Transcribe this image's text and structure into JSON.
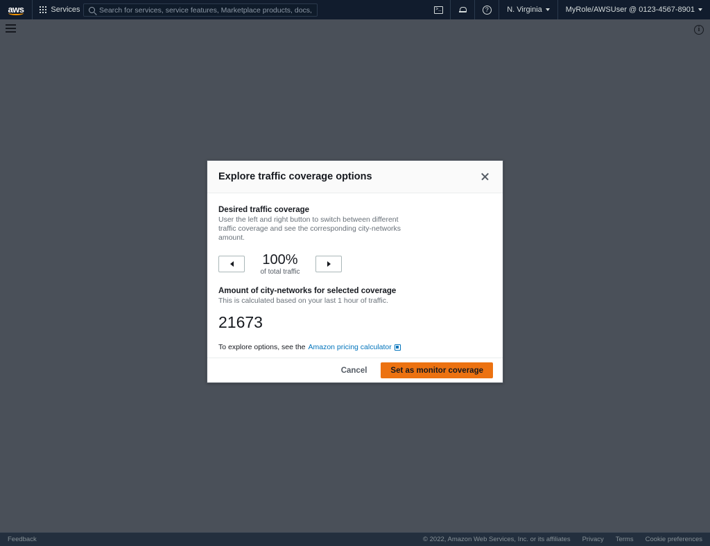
{
  "topnav": {
    "logo_text": "aws",
    "services_label": "Services",
    "search": {
      "placeholder": "Search for services, service features, Marketplace products, docs, and more"
    },
    "cloudshell_glyph": ">_",
    "help_glyph": "?",
    "region": "N. Virginia",
    "account": "MyRole/AWSUser @ 0123-4567-8901"
  },
  "subbar": {
    "info_glyph": "i"
  },
  "modal": {
    "title": "Explore traffic coverage options",
    "coverage": {
      "label": "Desired traffic coverage",
      "description": "User the left and right button to switch between different traffic coverage and see the corresponding city-networks amount.",
      "value": "100%",
      "value_sub": "of total traffic"
    },
    "amount": {
      "label": "Amount of city-networks for selected coverage",
      "description": "This is calculated based on your last 1 hour of traffic.",
      "value": "21673"
    },
    "explore": {
      "prefix": "To explore options, see the",
      "link_text": "Amazon pricing calculator"
    },
    "footer": {
      "cancel_label": "Cancel",
      "primary_label": "Set as monitor coverage"
    }
  },
  "footer": {
    "feedback": "Feedback",
    "copyright": "© 2022, Amazon Web Services, Inc. or its affiliates",
    "privacy": "Privacy",
    "terms": "Terms",
    "cookie_preferences": "Cookie preferences"
  },
  "colors": {
    "nav_bg": "#111c2d",
    "page_bg": "#4a5059",
    "accent_orange": "#ec7211",
    "link_blue": "#0073bb",
    "footer_bg": "#232f3e"
  }
}
